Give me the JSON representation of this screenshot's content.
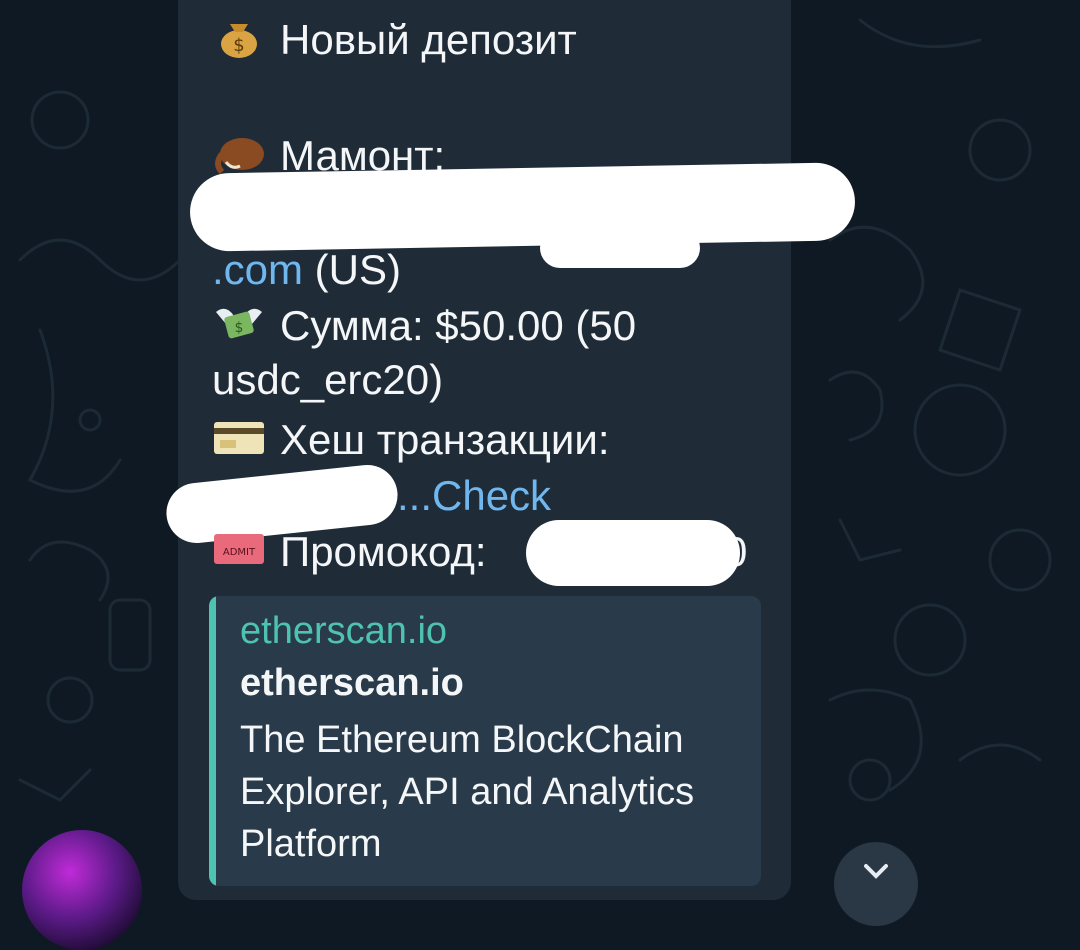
{
  "message": {
    "title": "Новый депозит",
    "mammoth_label": "Мамонт:",
    "domain_suffix": ".com",
    "country": " (US)",
    "amount_line1": "Сумма: $50.00 (50",
    "amount_line2": "usdc_erc20)",
    "hash_label": "Хеш транзакции:",
    "hash_link_suffix": "...Check",
    "promo_label": "Промокод:",
    "promo_tail": "0"
  },
  "link_preview": {
    "site": "etherscan.io",
    "title": "etherscan.io",
    "description": "The Ethereum BlockChain Explorer, API and Analytics Platform"
  },
  "colors": {
    "background": "#0f1923",
    "bubble": "#1f2c38",
    "link": "#6fb7ee",
    "preview_accent": "#4fc3b1"
  },
  "icons": [
    "money-bag-icon",
    "mammoth-icon",
    "money-wings-icon",
    "credit-card-icon",
    "ticket-icon",
    "scroll-down-icon"
  ]
}
